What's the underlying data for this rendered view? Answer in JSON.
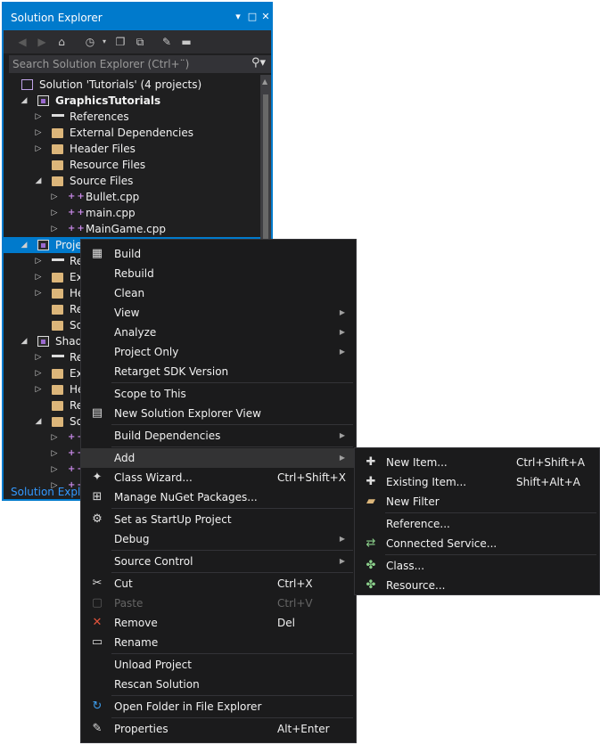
{
  "solution_explorer": {
    "title": "Solution Explorer",
    "title_buttons": [
      "▾",
      "□",
      "✕"
    ],
    "search_placeholder": "Search Solution Explorer (Ctrl+¨)",
    "bottom_tab": "Solution Explorer",
    "tree": [
      {
        "label": "Solution 'Tutorials' (4 projects)",
        "icon": "solution-icon",
        "expander": "",
        "indent": 0,
        "bold": false
      },
      {
        "label": "GraphicsTutorials",
        "icon": "project-icon",
        "expander": "expanded",
        "indent": 1,
        "bold": true
      },
      {
        "label": "References",
        "icon": "references-icon",
        "expander": "collapsed",
        "indent": 2,
        "bold": false
      },
      {
        "label": "External Dependencies",
        "icon": "folder-icon",
        "expander": "collapsed",
        "indent": 2,
        "bold": false
      },
      {
        "label": "Header Files",
        "icon": "folder-icon",
        "expander": "collapsed",
        "indent": 2,
        "bold": false
      },
      {
        "label": "Resource Files",
        "icon": "folder-icon",
        "expander": "",
        "indent": 2,
        "bold": false
      },
      {
        "label": "Source Files",
        "icon": "folder-icon",
        "expander": "expanded",
        "indent": 2,
        "bold": false
      },
      {
        "label": "Bullet.cpp",
        "icon": "cpp-file-icon",
        "expander": "collapsed",
        "indent": 3,
        "bold": false
      },
      {
        "label": "main.cpp",
        "icon": "cpp-file-icon",
        "expander": "collapsed",
        "indent": 3,
        "bold": false
      },
      {
        "label": "MainGame.cpp",
        "icon": "cpp-file-icon",
        "expander": "collapsed",
        "indent": 3,
        "bold": false
      },
      {
        "label": "Projec",
        "icon": "project-icon",
        "expander": "expanded",
        "indent": 1,
        "bold": false,
        "selected": true
      },
      {
        "label": "Re",
        "icon": "references-icon",
        "expander": "collapsed",
        "indent": 2,
        "bold": false
      },
      {
        "label": "Ext",
        "icon": "folder-icon",
        "expander": "collapsed",
        "indent": 2,
        "bold": false
      },
      {
        "label": "He",
        "icon": "folder-icon",
        "expander": "collapsed",
        "indent": 2,
        "bold": false
      },
      {
        "label": "Re",
        "icon": "folder-icon",
        "expander": "",
        "indent": 2,
        "bold": false
      },
      {
        "label": "So",
        "icon": "folder-icon",
        "expander": "",
        "indent": 2,
        "bold": false
      },
      {
        "label": "Shado",
        "icon": "project-icon",
        "expander": "expanded",
        "indent": 1,
        "bold": false
      },
      {
        "label": "Re",
        "icon": "references-icon",
        "expander": "collapsed",
        "indent": 2,
        "bold": false
      },
      {
        "label": "Ext",
        "icon": "folder-icon",
        "expander": "collapsed",
        "indent": 2,
        "bold": false
      },
      {
        "label": "He",
        "icon": "folder-icon",
        "expander": "collapsed",
        "indent": 2,
        "bold": false
      },
      {
        "label": "Re",
        "icon": "folder-icon",
        "expander": "",
        "indent": 2,
        "bold": false
      },
      {
        "label": "So",
        "icon": "folder-icon",
        "expander": "expanded",
        "indent": 2,
        "bold": false
      },
      {
        "label": "",
        "icon": "cpp-file-icon",
        "expander": "collapsed",
        "indent": 3,
        "bold": false
      },
      {
        "label": "",
        "icon": "cpp-file-icon",
        "expander": "collapsed",
        "indent": 3,
        "bold": false
      },
      {
        "label": "",
        "icon": "cpp-file-icon",
        "expander": "collapsed",
        "indent": 3,
        "bold": false
      },
      {
        "label": "",
        "icon": "cpp-file-icon",
        "expander": "collapsed",
        "indent": 3,
        "bold": false
      }
    ]
  },
  "context_menu": {
    "items": [
      {
        "label": "Build",
        "icon": "build-icon",
        "glyph": "▦"
      },
      {
        "label": "Rebuild"
      },
      {
        "label": "Clean"
      },
      {
        "label": "View",
        "submenu": true
      },
      {
        "label": "Analyze",
        "submenu": true
      },
      {
        "label": "Project Only",
        "submenu": true
      },
      {
        "label": "Retarget SDK Version"
      },
      {
        "separator": true
      },
      {
        "label": "Scope to This"
      },
      {
        "label": "New Solution Explorer View",
        "icon": "new-view-icon",
        "glyph": "▤"
      },
      {
        "separator": true
      },
      {
        "label": "Build Dependencies",
        "submenu": true
      },
      {
        "separator": true
      },
      {
        "label": "Add",
        "submenu": true,
        "highlighted": true
      },
      {
        "label": "Class Wizard...",
        "shortcut": "Ctrl+Shift+X",
        "icon": "class-wizard-icon",
        "glyph": "✦"
      },
      {
        "label": "Manage NuGet Packages...",
        "icon": "nuget-icon",
        "glyph": "⊞"
      },
      {
        "separator": true
      },
      {
        "label": "Set as StartUp Project",
        "icon": "gear-icon",
        "glyph": "⚙"
      },
      {
        "label": "Debug",
        "submenu": true
      },
      {
        "separator": true
      },
      {
        "label": "Source Control",
        "submenu": true
      },
      {
        "separator": true
      },
      {
        "label": "Cut",
        "shortcut": "Ctrl+X",
        "icon": "cut-icon",
        "glyph": "✂"
      },
      {
        "label": "Paste",
        "shortcut": "Ctrl+V",
        "icon": "paste-icon",
        "glyph": "▢",
        "disabled": true
      },
      {
        "label": "Remove",
        "shortcut": "Del",
        "icon": "remove-icon",
        "glyph": "✕",
        "glyph_color": "#e0533c"
      },
      {
        "label": "Rename",
        "icon": "rename-icon",
        "glyph": "▭"
      },
      {
        "separator": true
      },
      {
        "label": "Unload Project"
      },
      {
        "label": "Rescan Solution"
      },
      {
        "separator": true
      },
      {
        "label": "Open Folder in File Explorer",
        "icon": "open-folder-icon",
        "glyph": "↻",
        "glyph_color": "#3d9be9"
      },
      {
        "separator": true
      },
      {
        "label": "Properties",
        "shortcut": "Alt+Enter",
        "icon": "wrench-icon",
        "glyph": "✎"
      }
    ]
  },
  "add_submenu": {
    "items": [
      {
        "label": "New Item...",
        "shortcut": "Ctrl+Shift+A",
        "icon": "new-item-icon",
        "glyph": "✚",
        "glyph_color": "#dcdcdc"
      },
      {
        "label": "Existing Item...",
        "shortcut": "Shift+Alt+A",
        "icon": "existing-item-icon",
        "glyph": "✚",
        "glyph_color": "#dcdcdc"
      },
      {
        "label": "New Filter",
        "icon": "new-filter-icon",
        "glyph": "▰",
        "glyph_color": "#dcb67a"
      },
      {
        "separator": true
      },
      {
        "label": "Reference..."
      },
      {
        "label": "Connected Service...",
        "icon": "connected-service-icon",
        "glyph": "⇄",
        "glyph_color": "#8bd08b"
      },
      {
        "separator": true
      },
      {
        "label": "Class...",
        "icon": "class-icon",
        "glyph": "✤",
        "glyph_color": "#8bd08b"
      },
      {
        "label": "Resource...",
        "icon": "resource-icon",
        "glyph": "✤",
        "glyph_color": "#8bd08b"
      }
    ]
  }
}
